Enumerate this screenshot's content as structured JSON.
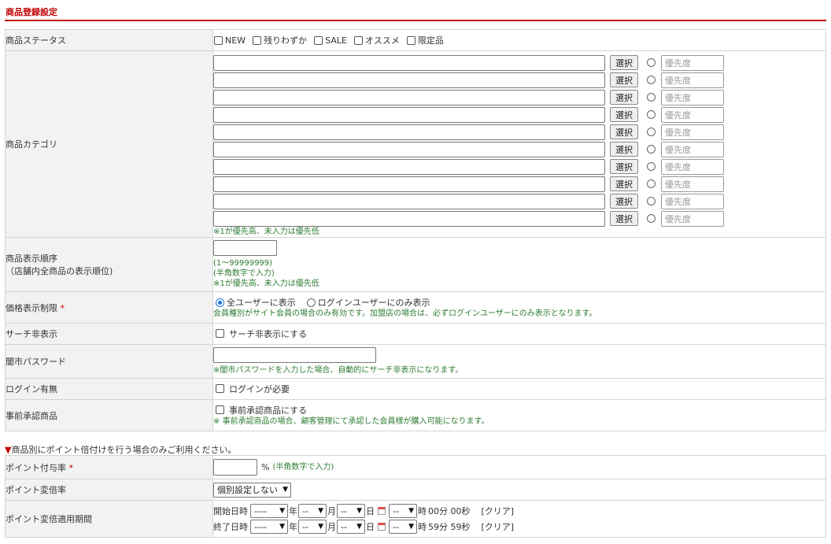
{
  "section": {
    "title": "商品登録設定"
  },
  "status_row": {
    "label": "商品ステータス",
    "options": [
      "NEW",
      "残りわずか",
      "SALE",
      "オススメ",
      "限定品"
    ]
  },
  "category_row": {
    "label": "商品カテゴリ",
    "select_label": "選択",
    "priority_placeholder": "優先度",
    "count": 10,
    "note": "※1が優先高、未入力は優先低"
  },
  "order_row": {
    "label": "商品表示順序",
    "sublabel": "（店舗内全商品の表示順位)",
    "note1": "(1～99999999)",
    "note2": "(半角数字で入力)",
    "note3": "※1が優先高、未入力は優先低"
  },
  "price_row": {
    "label": "価格表示制限",
    "required": "*",
    "option_all": "全ユーザーに表示",
    "option_login": "ログインユーザーにのみ表示",
    "note": "会員種別がサイト会員の場合のみ有効です。加盟店の場合は、必ずログインユーザーにのみ表示となります。"
  },
  "search_row": {
    "label": "サーチ非表示",
    "check": "サーチ非表示にする"
  },
  "password_row": {
    "label": "闇市パスワード",
    "note": "※闇市パスワードを入力した場合、自動的にサーチ非表示になります。"
  },
  "login_row": {
    "label": "ログイン有無",
    "check": "ログインが必要"
  },
  "approval_row": {
    "label": "事前承認商品",
    "check": "事前承認商品にする",
    "note": "※ 事前承認商品の場合、顧客管理にて承認した会員様が購入可能になります。"
  },
  "point_section_note": "商品別にポイント倍付けを行う場合のみご利用ください。",
  "point_section_marker": "▼",
  "point_rate_row": {
    "label": "ポイント付与率",
    "required": "*",
    "unit": "%",
    "note": "(半角数字で入力)"
  },
  "point_multiplier_row": {
    "label": "ポイント変倍率",
    "selected": "個別設定しない"
  },
  "point_period_row": {
    "label": "ポイント変倍適用期間",
    "start_label": "開始日時",
    "end_label": "終了日時",
    "year_placeholder": "----",
    "md_placeholder": "--",
    "year_unit": "年",
    "month_unit": "月",
    "day_unit": "日",
    "hour_unit": "時",
    "start_suffix": "00分 00秒",
    "end_suffix": "59分 59秒",
    "clear": "[クリア]"
  },
  "colors": {
    "accent": "#c00000",
    "note": "#2e7d32",
    "label_bg": "#f2f2f2"
  }
}
